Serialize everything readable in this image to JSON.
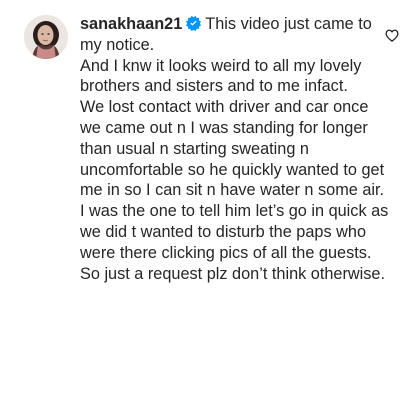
{
  "comment": {
    "username": "sanakhaan21",
    "verified": true,
    "first_line": "This video just came to my notice.",
    "body": "And I knw it looks weird to all my lovely brothers and sisters and to me infact.\nWe lost contact with driver and car once we came out n I was standing for longer than usual n starting sweating n uncomfortable so he quickly wanted to get me in so I can sit n have water n some air.\nI was the one to tell him let’s go in quick as we did t wanted to disturb the paps who were there clicking pics of all the guests.\nSo just a request plz don’t think otherwise.",
    "avatar_icon": "profile-photo",
    "like_icon": "heart-outline-icon"
  },
  "colors": {
    "text": "#262626",
    "verified_blue": "#0095f6",
    "background": "#ffffff"
  }
}
